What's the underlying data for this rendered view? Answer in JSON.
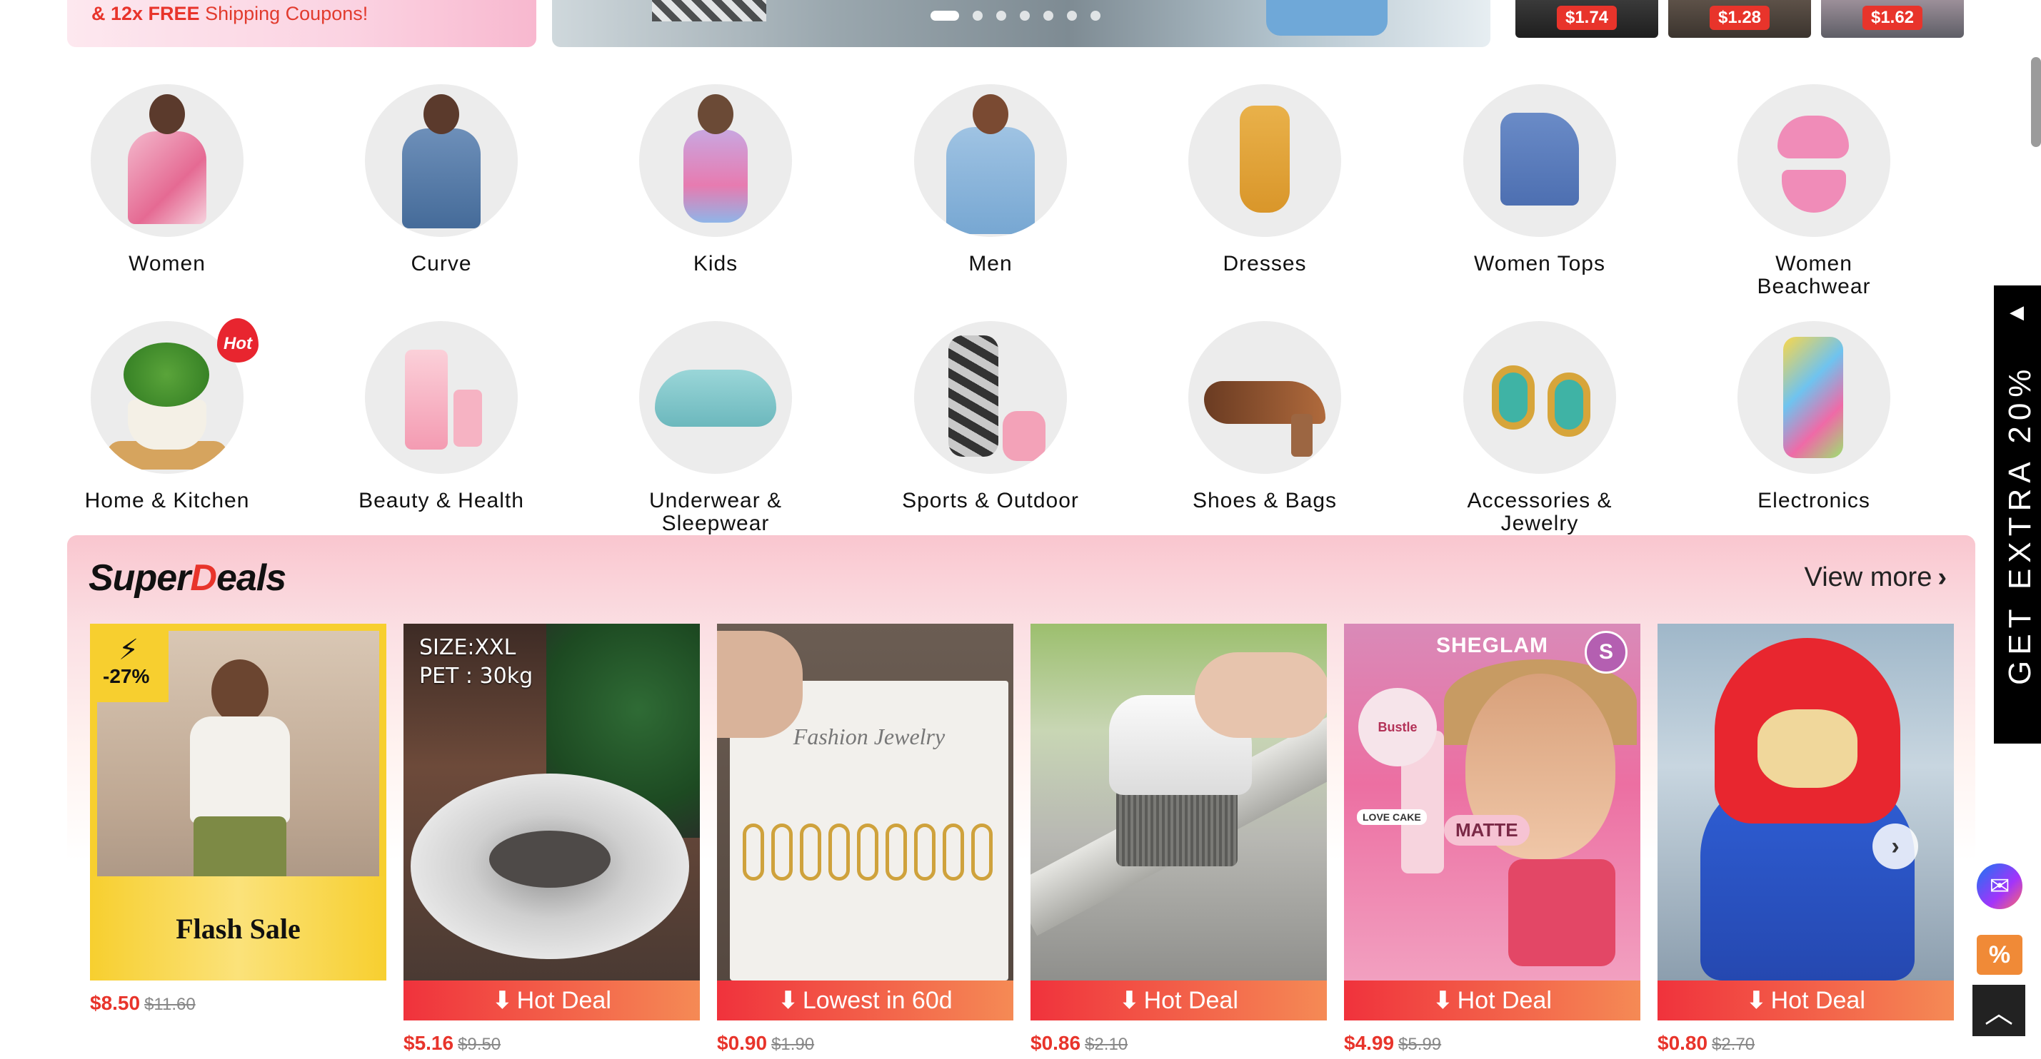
{
  "promo": {
    "highlight": "& 12x FREE",
    "text": "Shipping Coupons!"
  },
  "banner": {
    "slide_count": 7,
    "active_slide": 1
  },
  "mini_products": [
    {
      "price": "$1.74"
    },
    {
      "price": "$1.28"
    },
    {
      "price": "$1.62"
    }
  ],
  "categories": {
    "items": [
      {
        "label": "Women",
        "icon": "women-category-icon"
      },
      {
        "label": "Curve",
        "icon": "curve-category-icon"
      },
      {
        "label": "Kids",
        "icon": "kids-category-icon"
      },
      {
        "label": "Men",
        "icon": "men-category-icon"
      },
      {
        "label": "Dresses",
        "icon": "dresses-category-icon"
      },
      {
        "label": "Women Tops",
        "icon": "women-tops-category-icon"
      },
      {
        "label": "Women Beachwear",
        "icon": "beachwear-category-icon"
      },
      {
        "label": "Home & Kitchen",
        "icon": "home-kitchen-category-icon",
        "badge": "Hot"
      },
      {
        "label": "Beauty & Health",
        "icon": "beauty-category-icon"
      },
      {
        "label": "Underwear & Sleepwear",
        "icon": "underwear-category-icon"
      },
      {
        "label": "Sports & Outdoor",
        "icon": "sports-category-icon"
      },
      {
        "label": "Shoes & Bags",
        "icon": "shoes-category-icon"
      },
      {
        "label": "Accessories & Jewelry",
        "icon": "jewelry-category-icon"
      },
      {
        "label": "Electronics",
        "icon": "electronics-category-icon"
      }
    ]
  },
  "deals": {
    "title_prefix": "Super",
    "title_d": "D",
    "title_suffix": "eals",
    "view_more": "View more",
    "chevron": "›",
    "cards": [
      {
        "image_text": "Flash Sale",
        "badge": "-27%",
        "currency": "$",
        "price": "8.50",
        "old_price": "$11.60"
      },
      {
        "tag": "Hot Deal",
        "size_line1": "SIZE:XXL",
        "size_line2": "PET : 30kg",
        "currency": "$",
        "price": "5.16",
        "old_price": "$9.50"
      },
      {
        "tag": "Lowest in 60d",
        "brand": "Fashion Jewelry",
        "currency": "$",
        "price": "0.90",
        "old_price": "$1.90"
      },
      {
        "tag": "Hot Deal",
        "currency": "$",
        "price": "0.86",
        "old_price": "$2.10"
      },
      {
        "tag": "Hot Deal",
        "brand": "SHEGLAM",
        "logo": "S",
        "sticker": "LOVE CAKE",
        "matte": "MATTE",
        "bustle": "Bustle",
        "currency": "$",
        "price": "4.99",
        "old_price": "$5.99"
      },
      {
        "tag": "Hot Deal",
        "currency": "$",
        "price": "0.80",
        "old_price": "$2.70"
      }
    ],
    "tag_arrow": "⬇"
  },
  "side": {
    "extra_text": "GET EXTRA 20%",
    "coupon_symbol": "%",
    "top_symbol": "︿"
  },
  "colors": {
    "accent_red": "#e8342b",
    "deal_gradient_start": "#f0323c",
    "deal_gradient_end": "#f58a55",
    "flash_yellow": "#f7cf2f"
  }
}
